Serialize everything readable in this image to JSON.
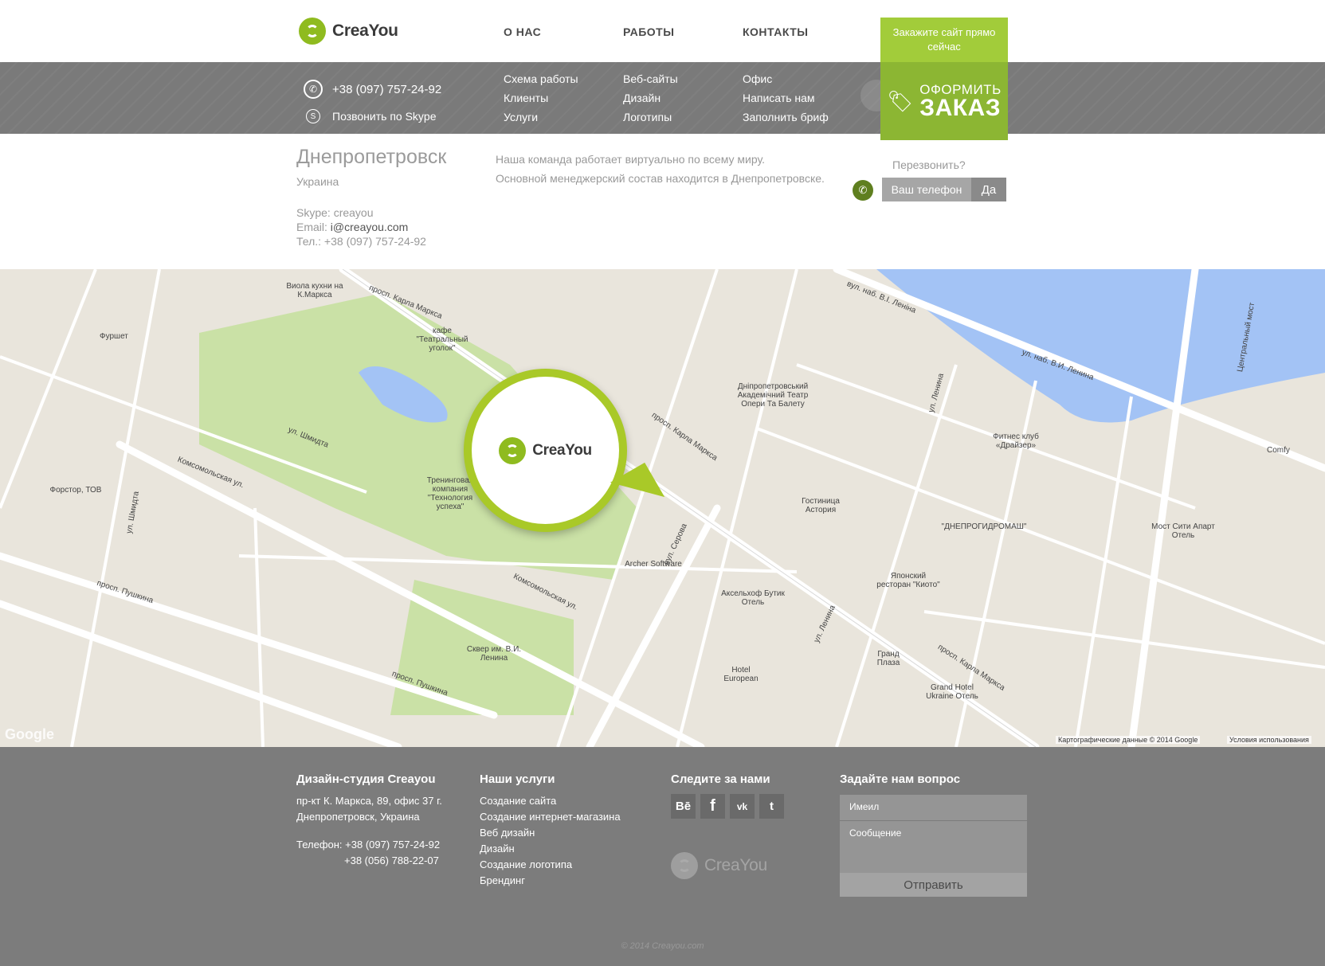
{
  "brand": {
    "name": "CreaYou"
  },
  "nav": {
    "top": [
      "О НАС",
      "РАБОТЫ",
      "КОНТАКТЫ"
    ],
    "col1": [
      "Схема работы",
      "Клиенты",
      "Услуги"
    ],
    "col2": [
      "Веб-сайты",
      "Дизайн",
      "Логотипы"
    ],
    "col3": [
      "Офис",
      "Написать нам",
      "Заполнить бриф"
    ]
  },
  "header": {
    "phone": "+38 (097) 757-24-92",
    "skype_link": "Позвонить по Skype",
    "cta_top": "Закажите сайт прямо сейчас",
    "cta_line1": "ОФОРМИТЬ",
    "cta_line2": "ЗАКАЗ"
  },
  "contacts": {
    "city": "Днепропетровск",
    "country": "Украина",
    "skype": "Skype: creayou",
    "email_label": "Email: ",
    "email": "i@creayou.com",
    "tel": "Тел.: +38 (097) 757-24-92",
    "desc1": "Наша команда работает виртуально по всему миру.",
    "desc2": "Основной менеджерский состав находится в Днепропетровске.",
    "callback_q": "Перезвонить?",
    "callback_placeholder": "Ваш телефон",
    "callback_yes": "Да"
  },
  "map": {
    "labels": [
      "просп. Карла Маркса",
      "Комсомольская ул.",
      "просп. Пушкина",
      "ул. Шмидта",
      "ул. Ленина",
      "вул. Серова",
      "вул. наб. В.І. Леніна",
      "ул. наб. В.И. Ленина",
      "Дніпропетровський Академічний Театр Опери Та Балету",
      "Гостиница Астория",
      "Archer Software",
      "Аксельхоф Бутик Отель",
      "Сквер им. В.И. Ленина",
      "Grand Hotel Ukraine Отель",
      "Фитнес клуб «Драйзер»",
      "\"ДНЕПРОГИДРОМАШ\"",
      "Мост Сити Апарт Отель",
      "Hotel European",
      "Тренинговая компания \"Технология успеха\"",
      "кафе \"Театральный уголок\"",
      "Виола кухни на К.Маркса",
      "Фуршет",
      "Форстор, ТОВ",
      "Центральный мост",
      "Comfy",
      "Японский ресторан \"Киото\"",
      "Гранд Плаза"
    ],
    "copyright": "Картографические данные © 2014 Google",
    "terms": "Условия использования",
    "google": "Google"
  },
  "footer": {
    "studio_title": "Дизайн-студия Creayou",
    "address1": "пр-кт К. Маркса, 89, офис 37 г.",
    "address2": "Днепропетровск, Украина",
    "phone1": "Телефон: +38 (097) 757-24-92",
    "phone2": "+38 (056) 788-22-07",
    "services_title": "Наши услуги",
    "services": [
      "Создание сайта",
      "Создание интернет-магазина",
      "Веб дизайн",
      "Дизайн",
      "Создание логотипа",
      "Брендинг"
    ],
    "follow_title": "Следите за нами",
    "social": [
      "Bē",
      "f",
      "vk",
      "t"
    ],
    "ask_title": "Задайте нам вопрос",
    "email_placeholder": "Имеил",
    "message_placeholder": "Сообщение",
    "send": "Отправить",
    "copyright": "© 2014 Creayou.com"
  }
}
